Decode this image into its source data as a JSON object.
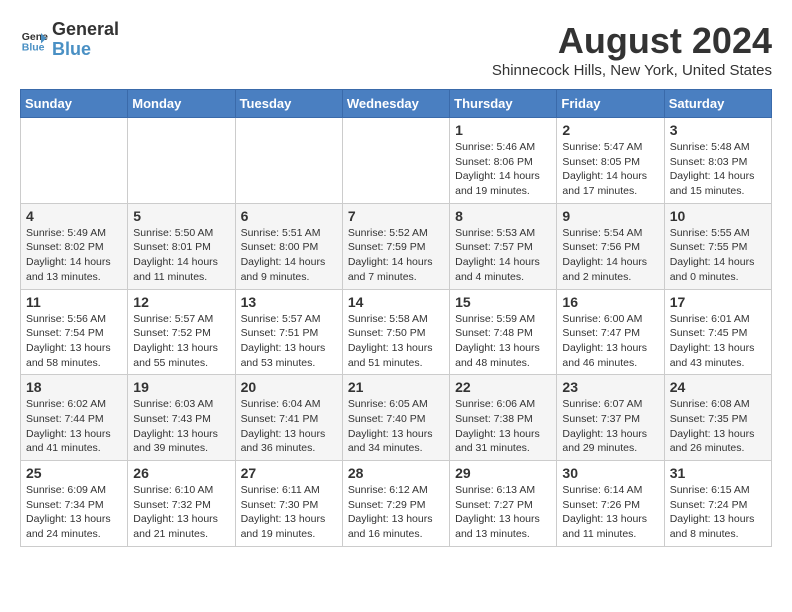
{
  "header": {
    "logo_line1": "General",
    "logo_line2": "Blue",
    "month_year": "August 2024",
    "location": "Shinnecock Hills, New York, United States"
  },
  "days_of_week": [
    "Sunday",
    "Monday",
    "Tuesday",
    "Wednesday",
    "Thursday",
    "Friday",
    "Saturday"
  ],
  "weeks": [
    [
      {
        "day": "",
        "info": ""
      },
      {
        "day": "",
        "info": ""
      },
      {
        "day": "",
        "info": ""
      },
      {
        "day": "",
        "info": ""
      },
      {
        "day": "1",
        "info": "Sunrise: 5:46 AM\nSunset: 8:06 PM\nDaylight: 14 hours\nand 19 minutes."
      },
      {
        "day": "2",
        "info": "Sunrise: 5:47 AM\nSunset: 8:05 PM\nDaylight: 14 hours\nand 17 minutes."
      },
      {
        "day": "3",
        "info": "Sunrise: 5:48 AM\nSunset: 8:03 PM\nDaylight: 14 hours\nand 15 minutes."
      }
    ],
    [
      {
        "day": "4",
        "info": "Sunrise: 5:49 AM\nSunset: 8:02 PM\nDaylight: 14 hours\nand 13 minutes."
      },
      {
        "day": "5",
        "info": "Sunrise: 5:50 AM\nSunset: 8:01 PM\nDaylight: 14 hours\nand 11 minutes."
      },
      {
        "day": "6",
        "info": "Sunrise: 5:51 AM\nSunset: 8:00 PM\nDaylight: 14 hours\nand 9 minutes."
      },
      {
        "day": "7",
        "info": "Sunrise: 5:52 AM\nSunset: 7:59 PM\nDaylight: 14 hours\nand 7 minutes."
      },
      {
        "day": "8",
        "info": "Sunrise: 5:53 AM\nSunset: 7:57 PM\nDaylight: 14 hours\nand 4 minutes."
      },
      {
        "day": "9",
        "info": "Sunrise: 5:54 AM\nSunset: 7:56 PM\nDaylight: 14 hours\nand 2 minutes."
      },
      {
        "day": "10",
        "info": "Sunrise: 5:55 AM\nSunset: 7:55 PM\nDaylight: 14 hours\nand 0 minutes."
      }
    ],
    [
      {
        "day": "11",
        "info": "Sunrise: 5:56 AM\nSunset: 7:54 PM\nDaylight: 13 hours\nand 58 minutes."
      },
      {
        "day": "12",
        "info": "Sunrise: 5:57 AM\nSunset: 7:52 PM\nDaylight: 13 hours\nand 55 minutes."
      },
      {
        "day": "13",
        "info": "Sunrise: 5:57 AM\nSunset: 7:51 PM\nDaylight: 13 hours\nand 53 minutes."
      },
      {
        "day": "14",
        "info": "Sunrise: 5:58 AM\nSunset: 7:50 PM\nDaylight: 13 hours\nand 51 minutes."
      },
      {
        "day": "15",
        "info": "Sunrise: 5:59 AM\nSunset: 7:48 PM\nDaylight: 13 hours\nand 48 minutes."
      },
      {
        "day": "16",
        "info": "Sunrise: 6:00 AM\nSunset: 7:47 PM\nDaylight: 13 hours\nand 46 minutes."
      },
      {
        "day": "17",
        "info": "Sunrise: 6:01 AM\nSunset: 7:45 PM\nDaylight: 13 hours\nand 43 minutes."
      }
    ],
    [
      {
        "day": "18",
        "info": "Sunrise: 6:02 AM\nSunset: 7:44 PM\nDaylight: 13 hours\nand 41 minutes."
      },
      {
        "day": "19",
        "info": "Sunrise: 6:03 AM\nSunset: 7:43 PM\nDaylight: 13 hours\nand 39 minutes."
      },
      {
        "day": "20",
        "info": "Sunrise: 6:04 AM\nSunset: 7:41 PM\nDaylight: 13 hours\nand 36 minutes."
      },
      {
        "day": "21",
        "info": "Sunrise: 6:05 AM\nSunset: 7:40 PM\nDaylight: 13 hours\nand 34 minutes."
      },
      {
        "day": "22",
        "info": "Sunrise: 6:06 AM\nSunset: 7:38 PM\nDaylight: 13 hours\nand 31 minutes."
      },
      {
        "day": "23",
        "info": "Sunrise: 6:07 AM\nSunset: 7:37 PM\nDaylight: 13 hours\nand 29 minutes."
      },
      {
        "day": "24",
        "info": "Sunrise: 6:08 AM\nSunset: 7:35 PM\nDaylight: 13 hours\nand 26 minutes."
      }
    ],
    [
      {
        "day": "25",
        "info": "Sunrise: 6:09 AM\nSunset: 7:34 PM\nDaylight: 13 hours\nand 24 minutes."
      },
      {
        "day": "26",
        "info": "Sunrise: 6:10 AM\nSunset: 7:32 PM\nDaylight: 13 hours\nand 21 minutes."
      },
      {
        "day": "27",
        "info": "Sunrise: 6:11 AM\nSunset: 7:30 PM\nDaylight: 13 hours\nand 19 minutes."
      },
      {
        "day": "28",
        "info": "Sunrise: 6:12 AM\nSunset: 7:29 PM\nDaylight: 13 hours\nand 16 minutes."
      },
      {
        "day": "29",
        "info": "Sunrise: 6:13 AM\nSunset: 7:27 PM\nDaylight: 13 hours\nand 13 minutes."
      },
      {
        "day": "30",
        "info": "Sunrise: 6:14 AM\nSunset: 7:26 PM\nDaylight: 13 hours\nand 11 minutes."
      },
      {
        "day": "31",
        "info": "Sunrise: 6:15 AM\nSunset: 7:24 PM\nDaylight: 13 hours\nand 8 minutes."
      }
    ]
  ]
}
